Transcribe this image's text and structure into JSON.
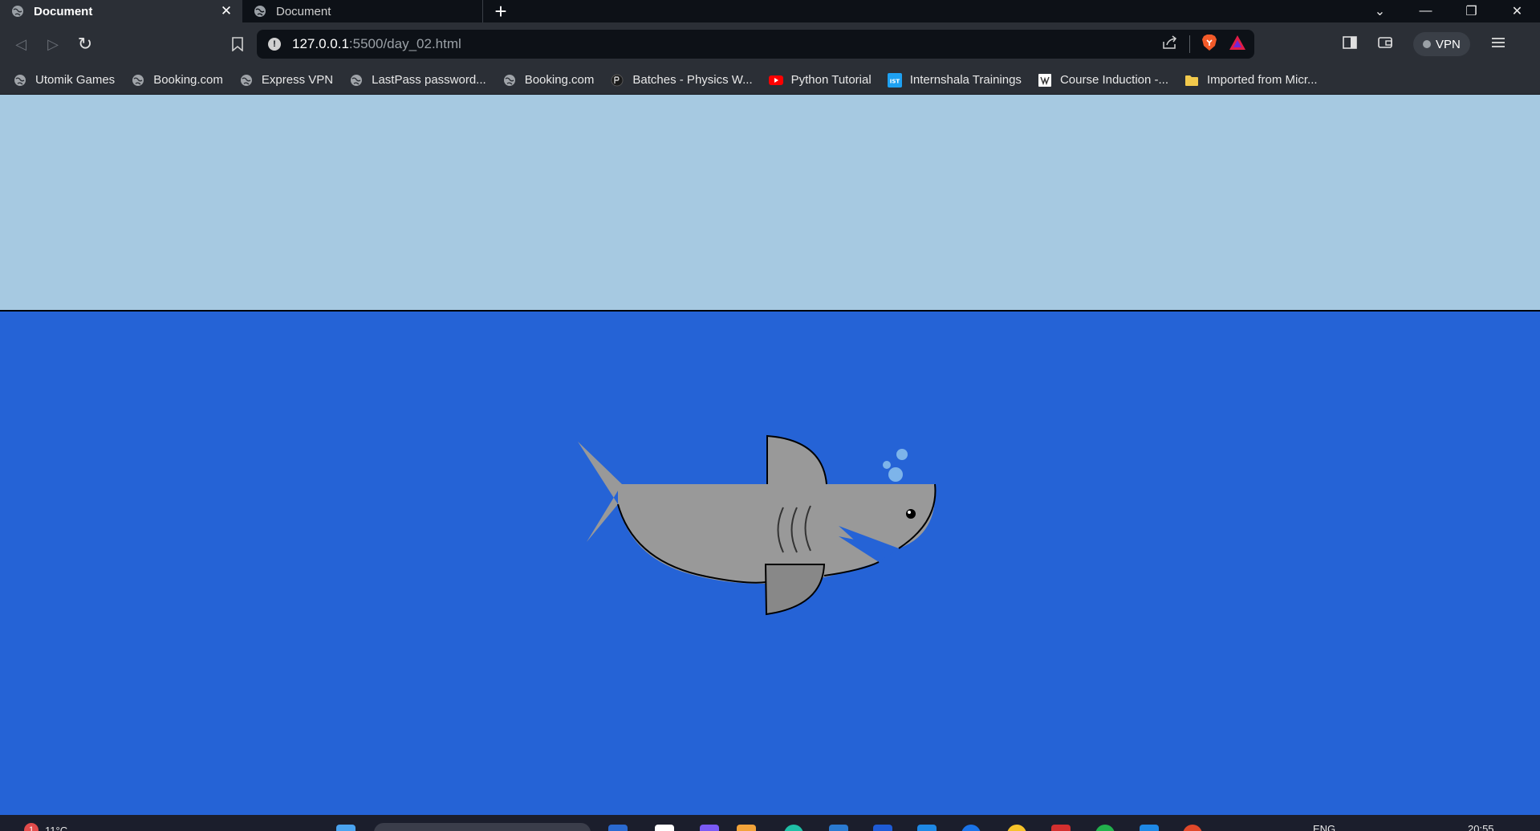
{
  "tabs": [
    {
      "title": "Document",
      "active": true,
      "close_icon": "close-icon"
    },
    {
      "title": "Document",
      "active": false
    }
  ],
  "new_tab_label": "+",
  "window_controls": {
    "dropdown": "⌄",
    "minimize": "—",
    "restore": "❐",
    "close": "✕"
  },
  "toolbar": {
    "back_icon": "◁",
    "forward_icon": "▷",
    "reload_icon": "↻",
    "url_host": "127.0.0.1",
    "url_path": ":5500/day_02.html",
    "vpn_label": "VPN"
  },
  "bookmarks": [
    {
      "label": "Utomik Games",
      "icon": "globe-icon"
    },
    {
      "label": "Booking.com",
      "icon": "globe-icon"
    },
    {
      "label": "Express VPN",
      "icon": "globe-icon"
    },
    {
      "label": "LastPass password...",
      "icon": "globe-icon"
    },
    {
      "label": "Booking.com",
      "icon": "globe-icon"
    },
    {
      "label": "Batches - Physics W...",
      "icon": "physicswallah-icon"
    },
    {
      "label": "Python Tutorial",
      "icon": "youtube-icon"
    },
    {
      "label": "Internshala Trainings",
      "icon": "internshala-icon"
    },
    {
      "label": "Course Induction -...",
      "icon": "course-icon"
    },
    {
      "label": "Imported from Micr...",
      "icon": "folder-icon"
    }
  ],
  "page": {
    "sky_color": "#a6c9e1",
    "sea_color": "#2563d6",
    "shark_color": "#999999",
    "fin_color": "#888888"
  },
  "taskbar": {
    "weather": "11°C",
    "notification_count": "1",
    "language": "ENG",
    "time": "20:55"
  }
}
